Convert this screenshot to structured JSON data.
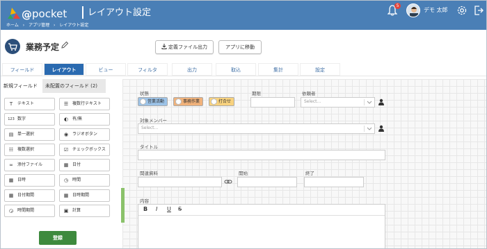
{
  "app": {
    "logo_at": "@",
    "logo_text": "pocket",
    "screen_title": "レイアウト設定",
    "breadcrumbs": [
      "ホーム",
      "›",
      "アプリ管理",
      "›",
      "レイアウト設定"
    ],
    "notification_count": "5",
    "username": "デモ 太郎"
  },
  "header": {
    "app_name": "業務予定",
    "export_label": "定義ファイル出力",
    "move_label": "アプリに移動"
  },
  "tabs": [
    {
      "label": "フィールド",
      "active": false
    },
    {
      "label": "レイアウト",
      "active": true
    },
    {
      "label": "ビュー",
      "active": false
    },
    {
      "label": "フィルタ",
      "active": false
    },
    {
      "label": "出力",
      "active": false
    },
    {
      "label": "取込",
      "active": false
    },
    {
      "label": "集計",
      "active": false
    },
    {
      "label": "設定",
      "active": false
    }
  ],
  "left_panel": {
    "tab_new": "新規フィールド",
    "tab_unplaced": "未配置のフィールド (2)",
    "fields": [
      {
        "label": "テキスト",
        "icon": "text-icon"
      },
      {
        "label": "複数行テキスト",
        "icon": "multiline-icon"
      },
      {
        "label": "数字",
        "icon": "number-icon"
      },
      {
        "label": "有/無",
        "icon": "toggle-icon"
      },
      {
        "label": "単一選択",
        "icon": "list-icon"
      },
      {
        "label": "ラジオボタン",
        "icon": "radio-icon"
      },
      {
        "label": "複数選択",
        "icon": "checklist-icon"
      },
      {
        "label": "チェックボックス",
        "icon": "checkbox-icon"
      },
      {
        "label": "添付ファイル",
        "icon": "attachment-icon"
      },
      {
        "label": "日付",
        "icon": "calendar-icon"
      },
      {
        "label": "日時",
        "icon": "calendar-time-icon"
      },
      {
        "label": "時間",
        "icon": "clock-icon"
      },
      {
        "label": "日付期間",
        "icon": "date-range-icon"
      },
      {
        "label": "日時期間",
        "icon": "datetime-range-icon"
      },
      {
        "label": "時間期間",
        "icon": "time-range-icon"
      },
      {
        "label": "計算",
        "icon": "calculator-icon"
      }
    ],
    "submit_label": "登録"
  },
  "form": {
    "status_label": "状態",
    "status_options": [
      {
        "label": "営業活動",
        "color": "#9cc3e8"
      },
      {
        "label": "事務作業",
        "color": "#f1b27a"
      },
      {
        "label": "打合せ",
        "color": "#f8d27e"
      }
    ],
    "period_label": "期限",
    "requester_label": "依頼者",
    "requester_placeholder": "Select...",
    "members_label": "対象メンバー",
    "members_placeholder": "Select...",
    "title_label": "タイトル",
    "materials_label": "関連資料",
    "start_label": "開始",
    "end_label": "終了",
    "content_label": "内容",
    "editor_buttons": [
      "B",
      "I",
      "U",
      "S"
    ]
  },
  "colors": {
    "topbar": "#4a7fb6",
    "tab_active": "#2a6ab0",
    "submit": "#3d8a3d"
  }
}
